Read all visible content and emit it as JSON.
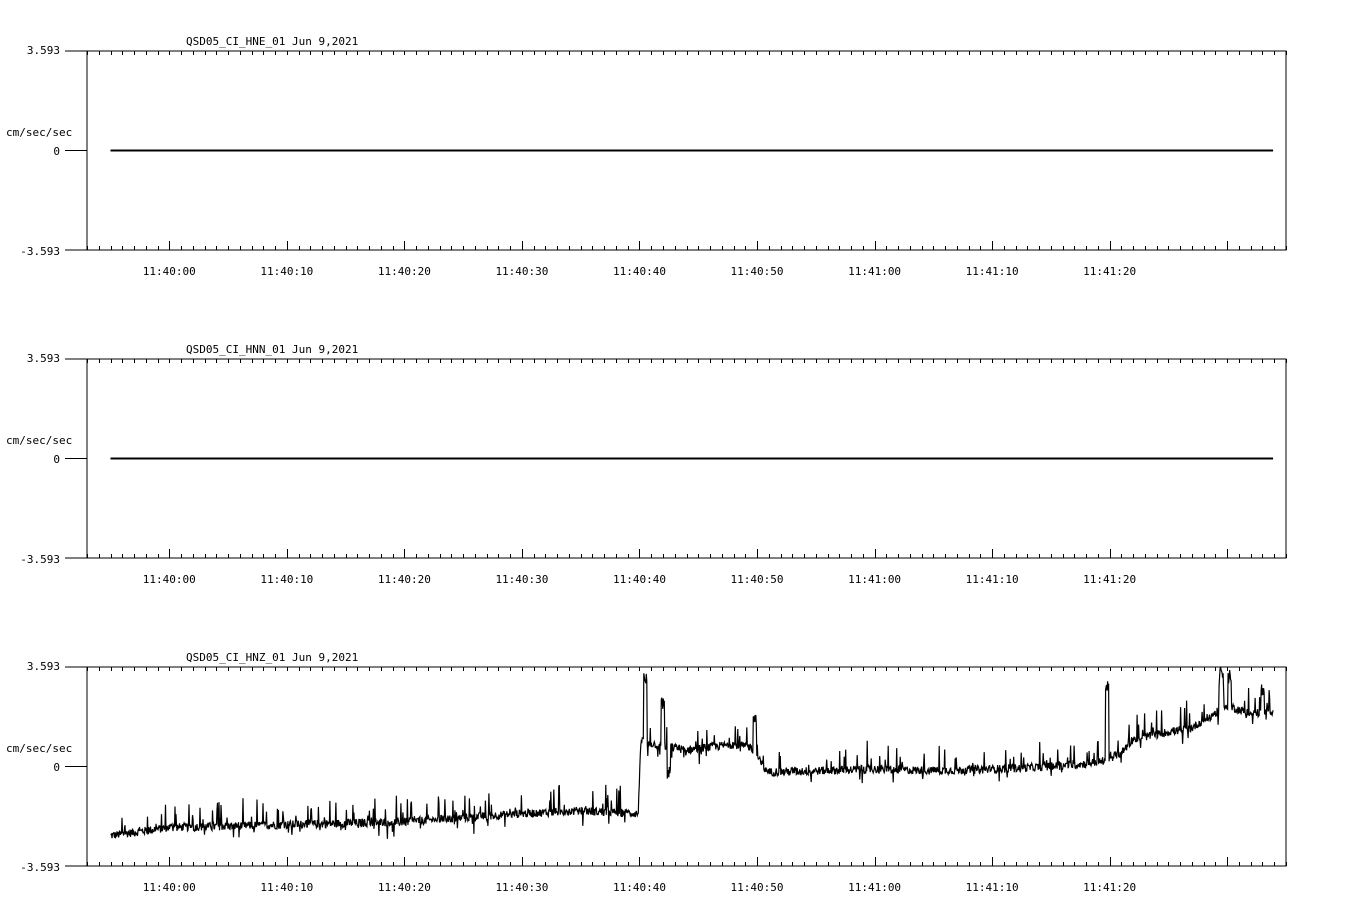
{
  "chart_data": [
    {
      "type": "line",
      "title": "QSD05_CI_HNE_01  Jun 9,2021",
      "ylabel": "cm/sec/sec",
      "ylim": [
        -3.593,
        3.593
      ],
      "yticks": [
        "3.593",
        "0",
        "-3.593"
      ],
      "xticks": [
        "11:40:00",
        "11:40:10",
        "11:40:20",
        "11:40:30",
        "11:40:40",
        "11:40:50",
        "11:41:00",
        "11:41:10",
        "11:41:20"
      ],
      "xlim_seconds_after_11_39_50": [
        3.0,
        105.0
      ],
      "series": [
        {
          "kind": "flat",
          "value": 0.0,
          "x_start": 5.0,
          "x_end": 103.9
        }
      ]
    },
    {
      "type": "line",
      "title": "QSD05_CI_HNN_01  Jun 9,2021",
      "ylabel": "cm/sec/sec",
      "ylim": [
        -3.593,
        3.593
      ],
      "yticks": [
        "3.593",
        "0",
        "-3.593"
      ],
      "xticks": [
        "11:40:00",
        "11:40:10",
        "11:40:20",
        "11:40:30",
        "11:40:40",
        "11:40:50",
        "11:41:00",
        "11:41:10",
        "11:41:20"
      ],
      "xlim_seconds_after_11_39_50": [
        3.0,
        105.0
      ],
      "series": [
        {
          "kind": "flat",
          "value": 0.0,
          "x_start": 5.0,
          "x_end": 103.9
        }
      ]
    },
    {
      "type": "line",
      "title": "QSD05_CI_HNZ_01  Jun 9,2021",
      "ylabel": "cm/sec/sec",
      "ylim": [
        -3.593,
        3.593
      ],
      "yticks": [
        "3.593",
        "0",
        "-3.593"
      ],
      "xticks": [
        "11:40:00",
        "11:40:10",
        "11:40:20",
        "11:40:30",
        "11:40:40",
        "11:40:50",
        "11:41:00",
        "11:41:10",
        "11:41:20"
      ],
      "xlim_seconds_after_11_39_50": [
        3.0,
        105.0
      ],
      "series": [
        {
          "kind": "noisy",
          "x_start": 5.0,
          "x_end": 103.9,
          "baseline": [
            [
              5.0,
              -2.5
            ],
            [
              10,
              -2.2
            ],
            [
              20,
              -2.1
            ],
            [
              30,
              -2.0
            ],
            [
              40,
              -1.7
            ],
            [
              45,
              -1.6
            ],
            [
              49.9,
              -1.7
            ],
            [
              50.1,
              0.9
            ],
            [
              54,
              0.6
            ],
            [
              58,
              0.8
            ],
            [
              59.5,
              0.7
            ],
            [
              60.8,
              -0.2
            ],
            [
              70,
              -0.1
            ],
            [
              75,
              -0.15
            ],
            [
              80,
              -0.1
            ],
            [
              85,
              0.0
            ],
            [
              88,
              0.1
            ],
            [
              89.5,
              0.2
            ],
            [
              91,
              0.5
            ],
            [
              92,
              1.0
            ],
            [
              97,
              1.4
            ],
            [
              100,
              2.2
            ],
            [
              102,
              1.9
            ],
            [
              103.9,
              2.0
            ]
          ],
          "noise": 0.15,
          "spike_rate": 0.12,
          "spike_amp": 0.9,
          "events": [
            [
              50.5,
              3.5
            ],
            [
              52.0,
              2.5
            ],
            [
              52.5,
              0.0
            ],
            [
              59.8,
              2.0
            ],
            [
              89.8,
              3.2
            ],
            [
              99.5,
              3.6
            ],
            [
              100.2,
              3.5
            ],
            [
              103.0,
              3.0
            ]
          ]
        }
      ]
    }
  ]
}
